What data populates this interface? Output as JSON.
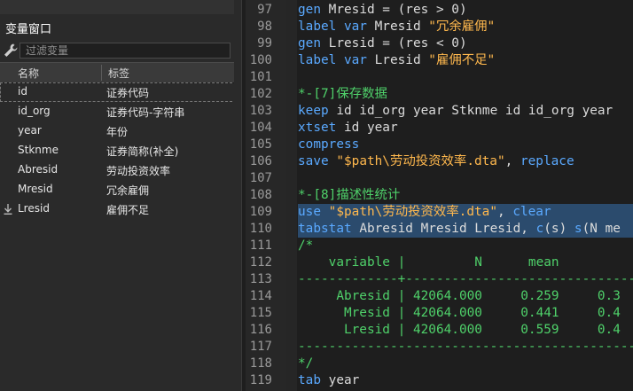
{
  "variables_panel": {
    "title": "变量窗口",
    "filter_placeholder": "过滤变量",
    "columns": {
      "name": "名称",
      "label": "标签"
    },
    "rows": [
      {
        "name": "id",
        "label": "证券代码"
      },
      {
        "name": "id_org",
        "label": "证券代码-字符串"
      },
      {
        "name": "year",
        "label": "年份"
      },
      {
        "name": "Stknme",
        "label": "证券简称(补全)"
      },
      {
        "name": "Abresid",
        "label": "劳动投资效率"
      },
      {
        "name": "Mresid",
        "label": "冗余雇佣"
      },
      {
        "name": "Lresid",
        "label": "雇佣不足"
      }
    ]
  },
  "editor": {
    "lines": [
      {
        "no": "97",
        "parts": [
          [
            "kw",
            "gen"
          ],
          [
            "pl",
            " Mresid = (res > 0)"
          ]
        ]
      },
      {
        "no": "98",
        "parts": [
          [
            "kw",
            "label var"
          ],
          [
            "pl",
            " Mresid "
          ],
          [
            "str",
            "\"冗余雇佣\""
          ]
        ]
      },
      {
        "no": "99",
        "parts": [
          [
            "kw",
            "gen"
          ],
          [
            "pl",
            " Lresid = (res < 0)"
          ]
        ]
      },
      {
        "no": "100",
        "parts": [
          [
            "kw",
            "label var"
          ],
          [
            "pl",
            " Lresid "
          ],
          [
            "str",
            "\"雇佣不足\""
          ]
        ]
      },
      {
        "no": "101",
        "parts": []
      },
      {
        "no": "102",
        "parts": [
          [
            "cm",
            "*-[7]保存数据"
          ]
        ]
      },
      {
        "no": "103",
        "parts": [
          [
            "kw",
            "keep"
          ],
          [
            "pl",
            " id id_org year Stknme id id_org year"
          ]
        ]
      },
      {
        "no": "104",
        "parts": [
          [
            "kw",
            "xtset"
          ],
          [
            "pl",
            " id year"
          ]
        ]
      },
      {
        "no": "105",
        "parts": [
          [
            "kw",
            "compress"
          ]
        ]
      },
      {
        "no": "106",
        "parts": [
          [
            "kw",
            "save"
          ],
          [
            "pl",
            " "
          ],
          [
            "str",
            "\"$path\\劳动投资效率.dta\""
          ],
          [
            "pl",
            ", "
          ],
          [
            "kw",
            "replace"
          ]
        ]
      },
      {
        "no": "107",
        "parts": []
      },
      {
        "no": "108",
        "parts": [
          [
            "cm",
            "*-[8]描述性统计"
          ]
        ]
      },
      {
        "no": "109",
        "sel": true,
        "parts": [
          [
            "kw",
            "use"
          ],
          [
            "pl",
            " "
          ],
          [
            "str",
            "\"$path\\劳动投资效率.dta\""
          ],
          [
            "pl",
            ", "
          ],
          [
            "kw",
            "clear"
          ]
        ]
      },
      {
        "no": "110",
        "sel": true,
        "parts": [
          [
            "kw",
            "tabstat"
          ],
          [
            "pl",
            " Abresid Mresid Lresid, "
          ],
          [
            "kw",
            "c"
          ],
          [
            "pl",
            "(s) "
          ],
          [
            "kw",
            "s"
          ],
          [
            "pl",
            "(N me"
          ]
        ]
      },
      {
        "no": "111",
        "parts": [
          [
            "cm",
            "/*"
          ]
        ]
      },
      {
        "no": "112",
        "parts": [
          [
            "cm",
            "    variable |         N      mean"
          ]
        ]
      },
      {
        "no": "113",
        "parts": [
          [
            "cm",
            "-------------+--------------------------------"
          ]
        ]
      },
      {
        "no": "114",
        "parts": [
          [
            "cm",
            "     Abresid | 42064.000     0.259     0.3"
          ]
        ]
      },
      {
        "no": "115",
        "parts": [
          [
            "cm",
            "      Mresid | 42064.000     0.441     0.4"
          ]
        ]
      },
      {
        "no": "116",
        "parts": [
          [
            "cm",
            "      Lresid | 42064.000     0.559     0.4"
          ]
        ]
      },
      {
        "no": "117",
        "parts": [
          [
            "cm",
            "----------------------------------------------"
          ]
        ]
      },
      {
        "no": "118",
        "parts": [
          [
            "cm",
            "*/"
          ]
        ]
      },
      {
        "no": "119",
        "parts": [
          [
            "kw",
            "tab"
          ],
          [
            "pl",
            " year"
          ]
        ]
      }
    ]
  }
}
